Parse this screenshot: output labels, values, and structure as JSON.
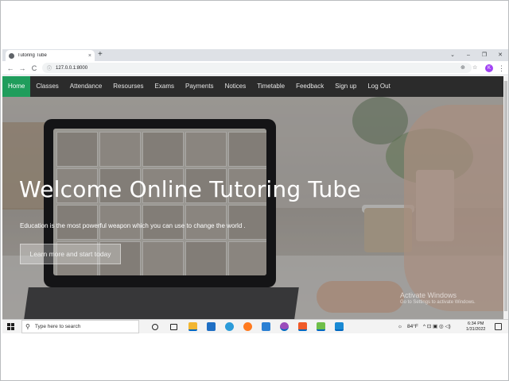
{
  "browser": {
    "tab_title": "Tutoring Tube",
    "tab_close": "×",
    "new_tab": "+",
    "url": "127.0.0.1:8000",
    "window_controls": [
      "⌄",
      "–",
      "❐",
      "✕"
    ],
    "nav_back": "←",
    "nav_forward": "→",
    "nav_reload": "C",
    "profile_initial": "K",
    "menu": "⋮"
  },
  "sitenav": {
    "items": [
      {
        "label": "Home",
        "active": true
      },
      {
        "label": "Classes"
      },
      {
        "label": "Attendance"
      },
      {
        "label": "Resourses"
      },
      {
        "label": "Exams"
      },
      {
        "label": "Payments"
      },
      {
        "label": "Notices"
      },
      {
        "label": "Timetable"
      },
      {
        "label": "Feedback"
      },
      {
        "label": "Sign up"
      },
      {
        "label": "Log Out"
      }
    ]
  },
  "hero": {
    "title": "Welcome Online Tutoring Tube",
    "subtitle": "Education is the most powerful weapon which you can use to change the world .",
    "cta_label": "Learn more and start today"
  },
  "watermark": {
    "line1": "Activate Windows",
    "line2": "Go to Settings to activate Windows."
  },
  "taskbar": {
    "search_placeholder": "Type here to search",
    "weather": "84°F",
    "tray_icons": "^ ⊡ ▣ ◎ ◁)",
    "time": "6:34 PM",
    "date": "1/31/2022"
  },
  "colors": {
    "nav_bg": "#2b2b2b",
    "nav_active": "#1f9d5c",
    "tab_strip": "#dee1e6"
  }
}
